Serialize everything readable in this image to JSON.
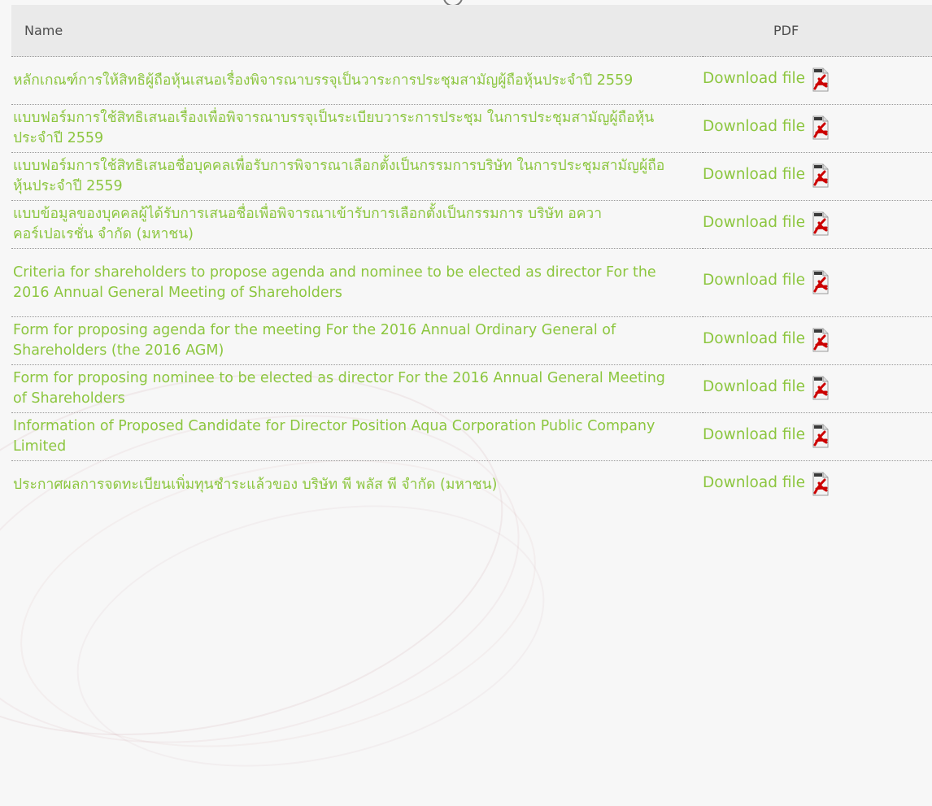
{
  "table": {
    "headers": {
      "name": "Name",
      "pdf": "PDF"
    },
    "link_color": "#8cc63f",
    "icon_color": "#cc0000",
    "rows": [
      {
        "title": "  หลักเกณฑ์การให้สิทธิผู้ถือหุ้นเสนอเรื่องพิจารณาบรรจุเป็นวาระการประชุมสามัญผู้ถือหุ้นประจำปี 2559",
        "link": "Download file",
        "icon": "pdf-icon"
      },
      {
        "title": "  แบบฟอร์มการใช้สิทธิเสนอเรื่องเพื่อพิจารณาบรรจุเป็นระเบียบวาระการประชุม ในการประชุมสามัญผู้ถือหุ้นประจำปี 2559",
        "link": "Download file",
        "icon": "pdf-icon"
      },
      {
        "title": "  แบบฟอร์มการใช้สิทธิเสนอชื่อบุคคลเพื่อรับการพิจารณาเลือกตั้งเป็นกรรมการบริษัท ในการประชุมสามัญผู้ถือหุ้นประจำปี 2559",
        "link": "Download file",
        "icon": "pdf-icon"
      },
      {
        "title": "  แบบข้อมูลของบุคคลผู้ได้รับการเสนอชื่อเพื่อพิจารณาเข้ารับการเลือกตั้งเป็นกรรมการ บริษัท อควา คอร์เปอเรชั่น จำกัด (มหาชน)",
        "link": "Download file",
        "icon": "pdf-icon"
      },
      {
        "title": "  Criteria for shareholders to propose agenda and nominee to be elected as director For the 2016 Annual General Meeting of Shareholders",
        "link": "Download file",
        "icon": "pdf-icon"
      },
      {
        "title": "  Form for proposing agenda for the meeting For the 2016 Annual Ordinary General of Shareholders (the 2016 AGM)",
        "link": "Download file",
        "icon": "pdf-icon"
      },
      {
        "title": "  Form for proposing nominee to be elected as director For the 2016 Annual General Meeting of Shareholders",
        "link": "Download file",
        "icon": "pdf-icon"
      },
      {
        "title": "  Information of Proposed Candidate for Director Position Aqua Corporation Public Company Limited",
        "link": "Download file",
        "icon": "pdf-icon"
      },
      {
        "title": "  ประกาศผลการจดทะเบียนเพิ่มทุนชำระแล้วของ บริษัท พี พลัส พี จำกัด (มหาชน)",
        "link": "Download file",
        "icon": "pdf-icon"
      }
    ]
  }
}
